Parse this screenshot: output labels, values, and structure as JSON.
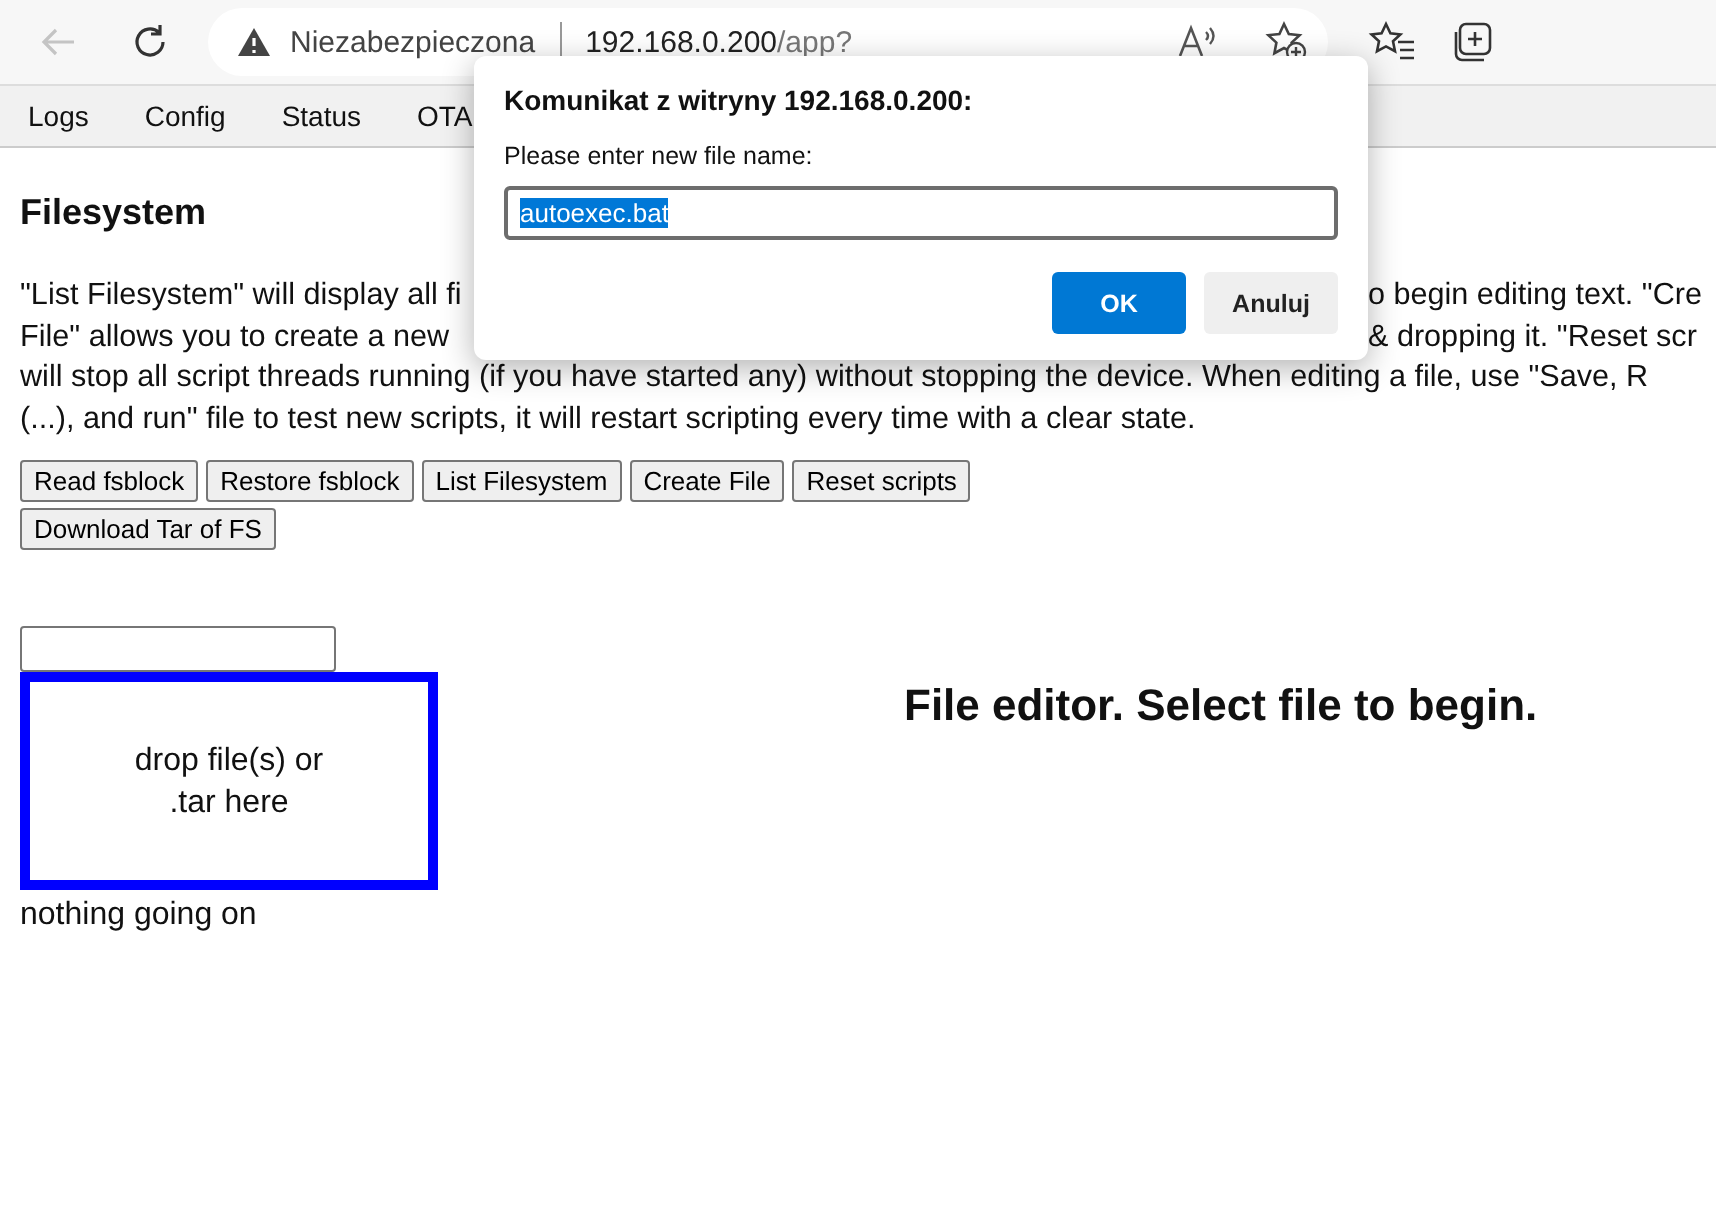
{
  "browser": {
    "security_label": "Niezabezpieczona",
    "url_host": "192.168.0.200",
    "url_path": "/app?"
  },
  "tabs": [
    {
      "label": "Logs"
    },
    {
      "label": "Config"
    },
    {
      "label": "Status"
    },
    {
      "label": "OTA"
    }
  ],
  "page": {
    "heading": "Filesystem",
    "description_lines": [
      {
        "left": "\"List Filesystem\" will display all fi",
        "right": "o begin editing text. \"Cre"
      },
      {
        "left": "File\" allows you to create a new",
        "right": "& dropping it. \"Reset scr"
      },
      {
        "left": "will stop all script threads running (if you have started any) without stopping the device. When editing a file, use \"Save, R"
      },
      {
        "left": "(...), and run\" file to test new scripts, it will restart scripting every time with a clear state."
      }
    ],
    "button_rows": [
      [
        "Read fsblock",
        "Restore fsblock",
        "List Filesystem",
        "Create File",
        "Reset scripts"
      ],
      [
        "Download Tar of FS"
      ]
    ],
    "drop_zone": "drop file(s) or\n.tar here",
    "status": "nothing going on",
    "editor_message": "File editor. Select file to begin."
  },
  "dialog": {
    "title": "Komunikat z witryny 192.168.0.200:",
    "prompt": "Please enter new file name:",
    "value": "autoexec.bat",
    "buttons": [
      {
        "label": "OK",
        "kind": "primary"
      },
      {
        "label": "Anuluj",
        "kind": "secondary"
      }
    ]
  }
}
